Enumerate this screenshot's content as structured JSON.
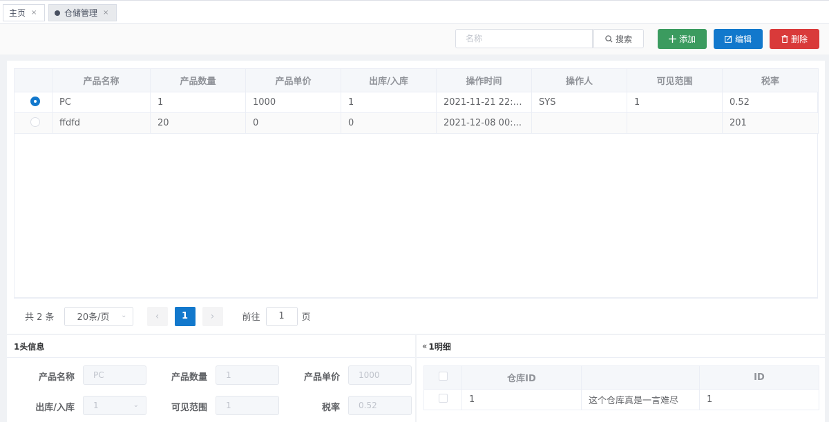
{
  "tabs": [
    {
      "label": "主页",
      "close": "×"
    },
    {
      "label": "仓储管理",
      "close": "×"
    }
  ],
  "toolbar": {
    "search_placeholder": "名称",
    "search_label": "搜索",
    "add_label": "添加",
    "edit_label": "编辑",
    "delete_label": "删除"
  },
  "grid": {
    "columns": [
      "产品名称",
      "产品数量",
      "产品单价",
      "出库/入库",
      "操作时间",
      "操作人",
      "可见范围",
      "税率"
    ],
    "rows": [
      {
        "name": "PC",
        "qty": "1",
        "price": "1000",
        "io": "1",
        "time": "2021-11-21 22:4...",
        "op": "SYS",
        "scope": "1",
        "tax": "0.52",
        "selected": true
      },
      {
        "name": "ffdfd",
        "qty": "20",
        "price": "0",
        "io": "0",
        "time": "2021-12-08 00:...",
        "op": "",
        "scope": "",
        "tax": "201",
        "selected": false
      }
    ]
  },
  "pager": {
    "total": "共 2 条",
    "page_size": "20条/页",
    "current": "1",
    "goto_label": "前往",
    "goto_value": "1",
    "page_label": "页"
  },
  "head_panel": {
    "title": "1头信息",
    "fields": [
      {
        "label": "产品名称",
        "value": "PC"
      },
      {
        "label": "产品数量",
        "value": "1"
      },
      {
        "label": "产品单价",
        "value": "1000"
      },
      {
        "label": "出库/入库",
        "value": "1"
      },
      {
        "label": "可见范围",
        "value": "1"
      },
      {
        "label": "税率",
        "value": "0.52"
      }
    ]
  },
  "detail_panel": {
    "title": "1明细",
    "columns": [
      "仓库ID",
      "",
      "ID"
    ],
    "rows": [
      {
        "warehouse_id": "1",
        "desc": "这个仓库真是一言难尽",
        "id": "1"
      }
    ]
  },
  "colors": {
    "primary": "#1278cc",
    "success": "#3b9b5f",
    "danger": "#d93a3a"
  }
}
